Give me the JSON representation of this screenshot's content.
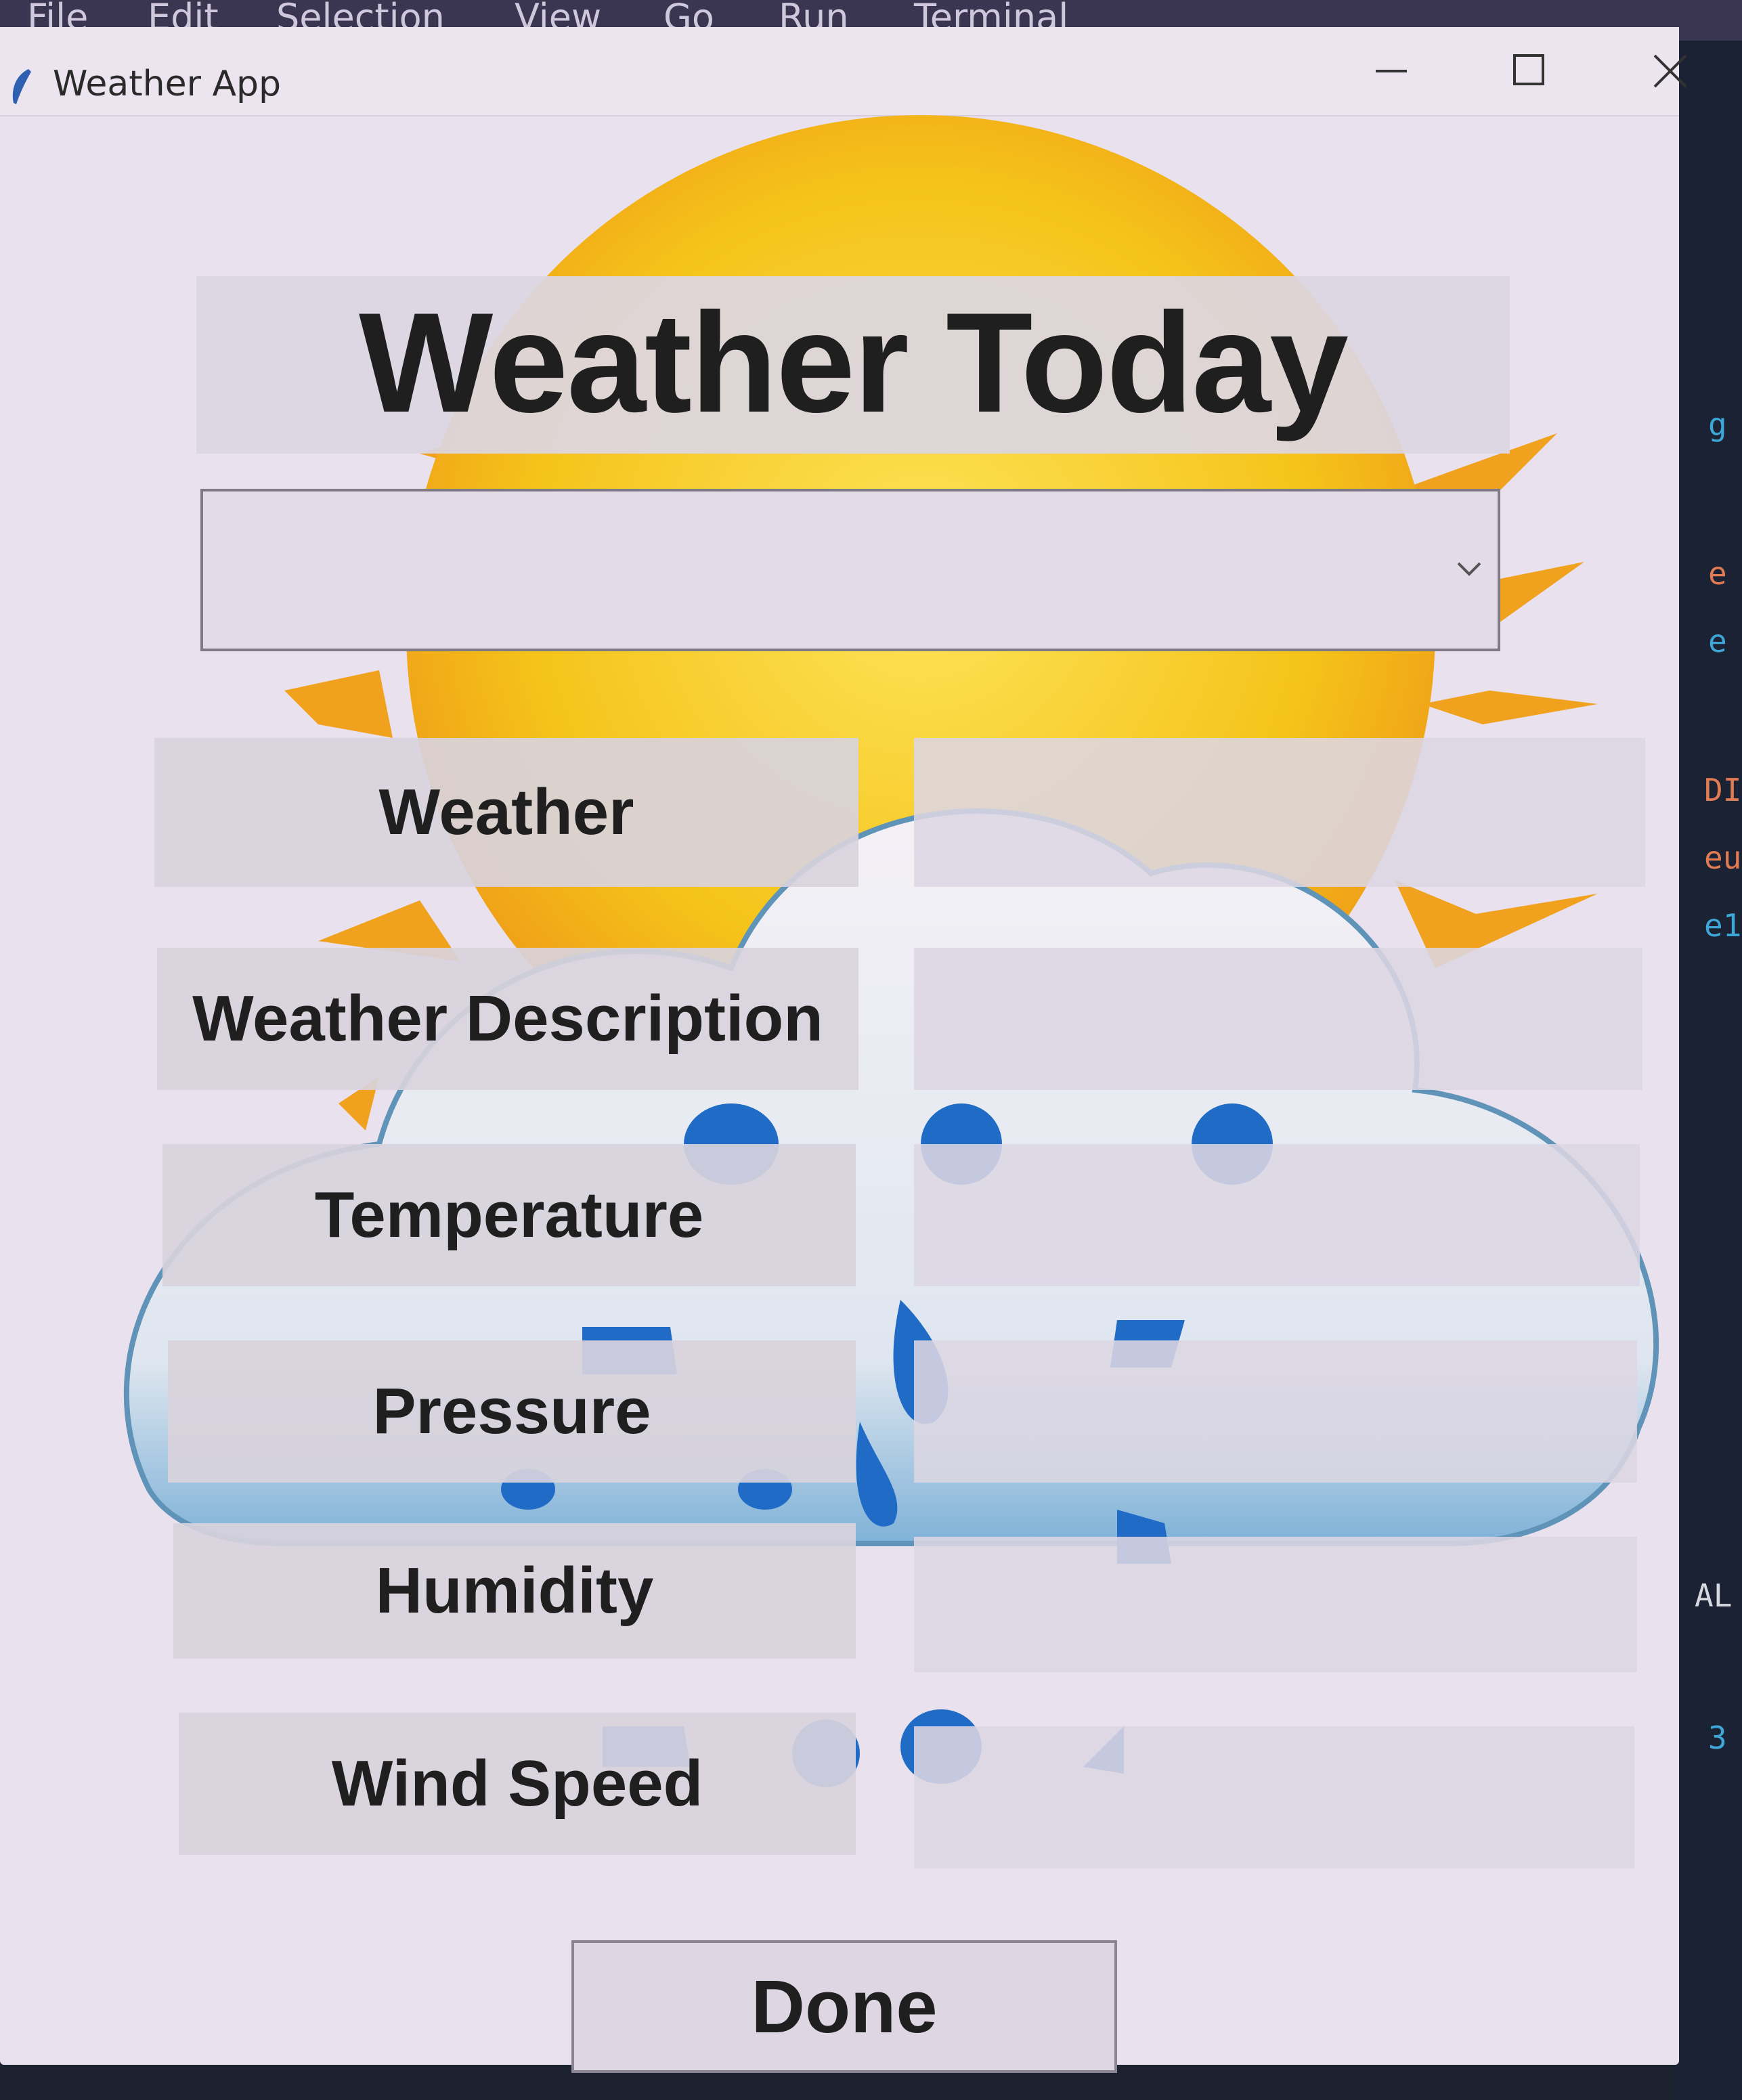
{
  "editor_menu": [
    "File",
    "Edit",
    "Selection",
    "View",
    "Go",
    "Run",
    "Terminal"
  ],
  "window": {
    "title": "Weather App"
  },
  "heading": "Weather Today",
  "city_select": {
    "value": ""
  },
  "fields": [
    {
      "label": "Weather",
      "value": ""
    },
    {
      "label": "Weather Description",
      "value": ""
    },
    {
      "label": "Temperature",
      "value": ""
    },
    {
      "label": "Pressure",
      "value": ""
    },
    {
      "label": "Humidity",
      "value": ""
    },
    {
      "label": "Wind Speed",
      "value": ""
    }
  ],
  "done_label": "Done",
  "background_right_text": [
    "g",
    "e",
    "e",
    "DI",
    "eu",
    "e1",
    "AL",
    "3"
  ],
  "colors": {
    "sun": "#f3c21c",
    "sun_ray": "#f0a11e",
    "raindrop": "#1f6bc6",
    "window_bg": "#e9e1ee"
  }
}
